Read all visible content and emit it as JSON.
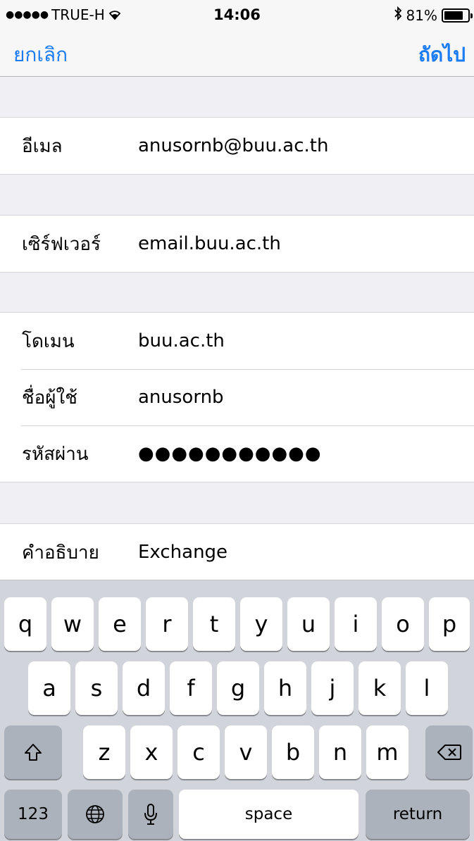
{
  "status_bar": {
    "signal_dots": "●●●●●",
    "carrier": "TRUE-H",
    "wifi_glyph": "ᯤ",
    "time": "14:06",
    "bluetooth_glyph": "✻",
    "battery_text": "81%",
    "battery_level": 0.81
  },
  "nav": {
    "cancel": "ยกเลิก",
    "next": "ถัดไป"
  },
  "form": {
    "email": {
      "label": "อีเมล",
      "value": "anusornb@buu.ac.th"
    },
    "server": {
      "label": "เซิร์ฟเวอร์",
      "value": "email.buu.ac.th"
    },
    "domain": {
      "label": "โดเมน",
      "value": "buu.ac.th"
    },
    "username": {
      "label": "ชื่อผู้ใช้",
      "value": "anusornb"
    },
    "password": {
      "label": "รหัสผ่าน",
      "value": "●●●●●●●●●●●"
    },
    "description": {
      "label": "คำอธิบาย",
      "value": "Exchange"
    }
  },
  "keyboard": {
    "row1": [
      "q",
      "w",
      "e",
      "r",
      "t",
      "y",
      "u",
      "i",
      "o",
      "p"
    ],
    "row2": [
      "a",
      "s",
      "d",
      "f",
      "g",
      "h",
      "j",
      "k",
      "l"
    ],
    "row3": [
      "z",
      "x",
      "c",
      "v",
      "b",
      "n",
      "m"
    ],
    "shift_glyph": "⇧",
    "delete_glyph": "⌫",
    "numbers": "123",
    "globe_glyph": "🌐",
    "mic_glyph": "🎙",
    "space": "space",
    "return": "return"
  }
}
